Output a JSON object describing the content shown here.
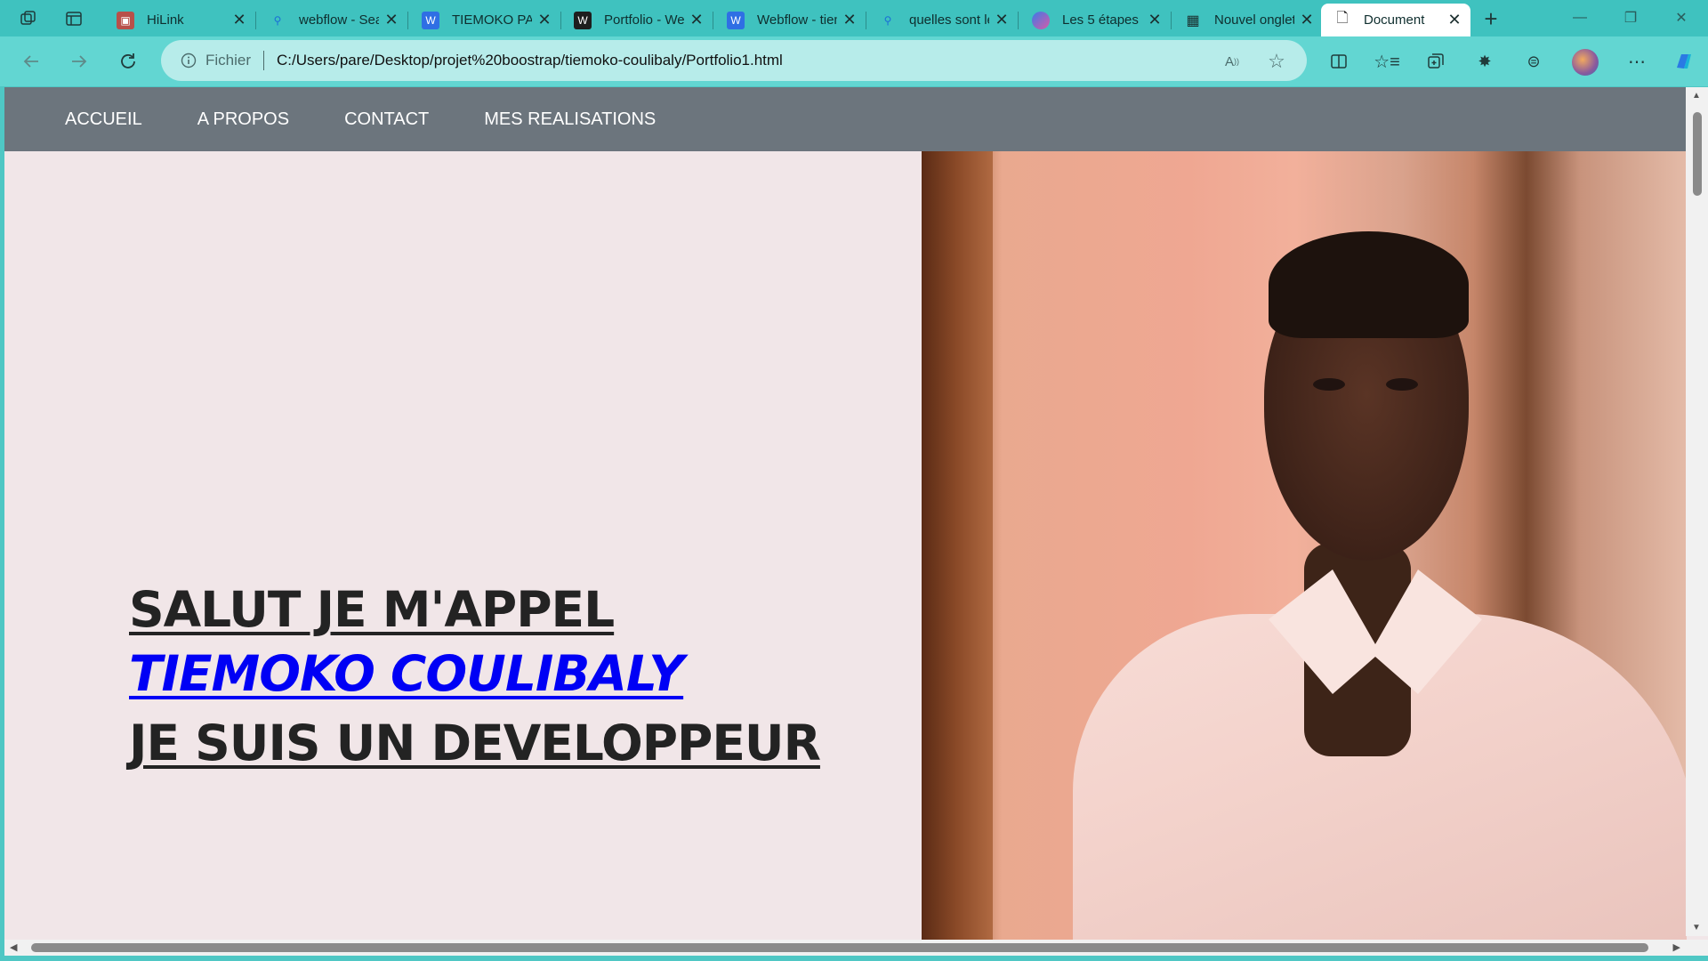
{
  "browser": {
    "tabs": [
      {
        "title": "HiLink",
        "icon": "hilink-favicon"
      },
      {
        "title": "webflow - Search",
        "icon": "search-favicon"
      },
      {
        "title": "TIEMOKO PARE",
        "icon": "webflow-favicon"
      },
      {
        "title": "Portfolio - Webflow",
        "icon": "webflow-dark-favicon"
      },
      {
        "title": "Webflow - tiemoko",
        "icon": "webflow-favicon"
      },
      {
        "title": "quelles sont les",
        "icon": "search-favicon"
      },
      {
        "title": "Les 5 étapes",
        "icon": "copilot-favicon"
      },
      {
        "title": "Nouvel onglet",
        "icon": "newtab-favicon"
      },
      {
        "title": "Document",
        "icon": "document-favicon",
        "active": true
      }
    ],
    "address": {
      "scheme_label": "Fichier",
      "url": "C:/Users/pare/Desktop/projet%20boostrap/tiemoko-coulibaly/Portfolio1.html"
    },
    "colors": {
      "tabstrip": "#3fc2bf",
      "toolbar": "#62d6d2",
      "address_bg": "#b7ecea"
    }
  },
  "page": {
    "nav": [
      "ACCUEIL",
      "A PROPOS",
      "CONTACT",
      "MES REALISATIONS"
    ],
    "hero": {
      "line1": "SALUT JE M'APPEL",
      "line2": "TIEMOKO COULIBALY",
      "line3": "JE SUIS UN DEVELOPPEUR"
    },
    "colors": {
      "navbar": "#6c757d",
      "background": "#f1e6e8",
      "name_color": "#0000f5"
    }
  }
}
